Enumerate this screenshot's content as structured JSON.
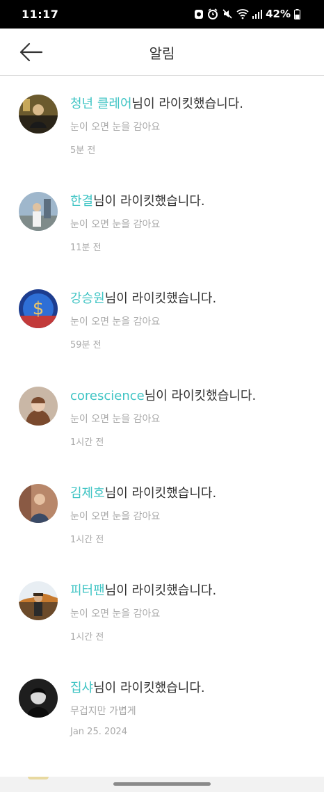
{
  "status_bar": {
    "time": "11:17",
    "battery": "42%"
  },
  "header": {
    "title": "알림"
  },
  "notifications": [
    {
      "username": "청년 클레어",
      "action": "님이 라이킷했습니다.",
      "post_title": "눈이 오면 눈을 감아요",
      "time": "5분 전"
    },
    {
      "username": "한결",
      "action": "님이 라이킷했습니다.",
      "post_title": "눈이 오면 눈을 감아요",
      "time": "11분 전"
    },
    {
      "username": "강승원",
      "action": "님이 라이킷했습니다.",
      "post_title": "눈이 오면 눈을 감아요",
      "time": "59분 전"
    },
    {
      "username": "corescience",
      "action": "님이 라이킷했습니다.",
      "post_title": "눈이 오면 눈을 감아요",
      "time": "1시간 전"
    },
    {
      "username": "김제호",
      "action": "님이 라이킷했습니다.",
      "post_title": "눈이 오면 눈을 감아요",
      "time": "1시간 전"
    },
    {
      "username": "피터팬",
      "action": "님이 라이킷했습니다.",
      "post_title": "눈이 오면 눈을 감아요",
      "time": "1시간 전"
    },
    {
      "username": "집샤",
      "action": "님이 라이킷했습니다.",
      "post_title": "무겁지만 가볍게",
      "time": "Jan 25. 2024"
    }
  ],
  "colors": {
    "accent": "#3fc4c4",
    "text": "#333333",
    "muted": "#a9a9a9"
  }
}
